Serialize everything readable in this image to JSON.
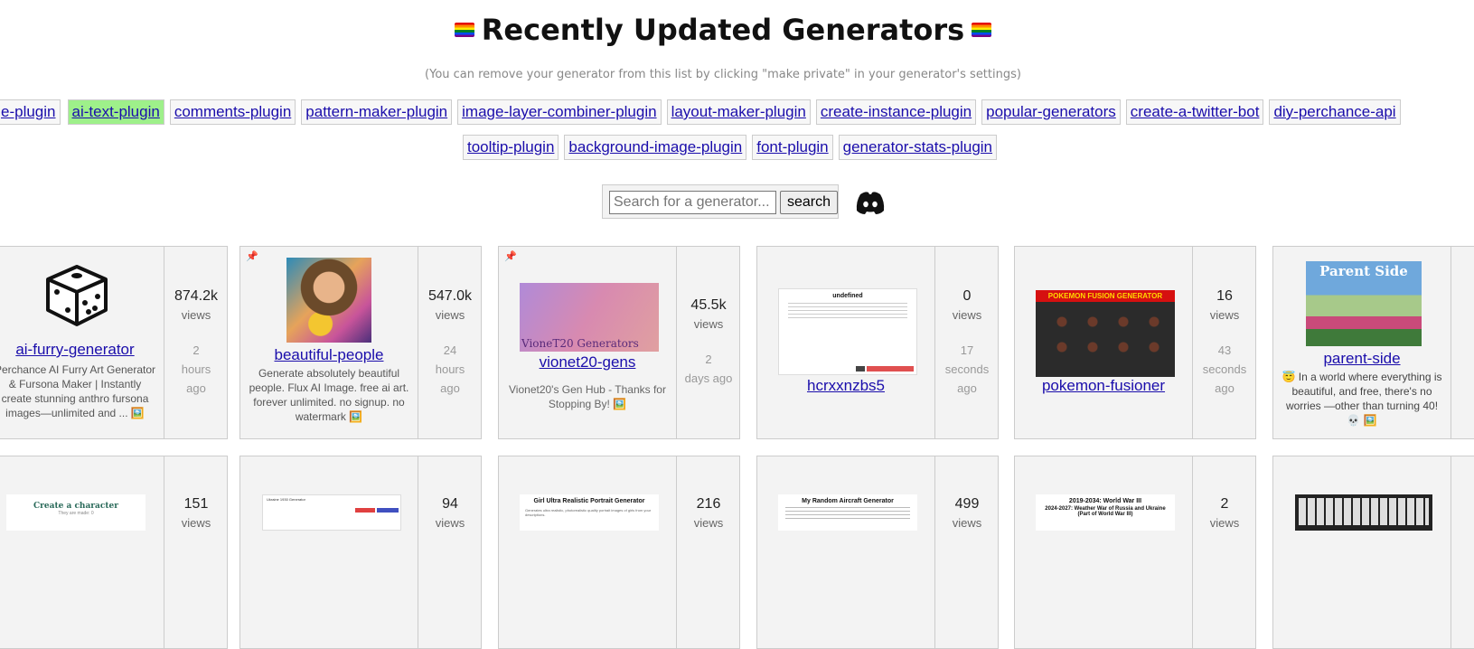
{
  "header": {
    "title": "Recently Updated Generators",
    "subtitle": "(You can remove your generator from this list by clicking \"make private\" in your generator's settings)"
  },
  "tags_row1": [
    "e-plugin",
    "ai-text-plugin",
    "comments-plugin",
    "pattern-maker-plugin",
    "image-layer-combiner-plugin",
    "layout-maker-plugin",
    "create-instance-plugin",
    "popular-generators",
    "create-a-twitter-bot",
    "diy-perchance-api"
  ],
  "tags_row2": [
    "tooltip-plugin",
    "background-image-plugin",
    "font-plugin",
    "generator-stats-plugin"
  ],
  "active_tag": "ai-text-plugin",
  "search": {
    "placeholder": "Search for a generator...",
    "button": "search"
  },
  "cards_row1": [
    {
      "name": "ai-furry-generator",
      "views": "874.2k",
      "views_label": "views",
      "ago": [
        "2",
        "hours",
        "ago"
      ],
      "desc": "Perchance AI Furry Art Generator & Fursona Maker | Instantly create stunning anthro fursona images—unlimited and ... 🖼️"
    },
    {
      "name": "beautiful-people",
      "views": "547.0k",
      "views_label": "views",
      "ago": [
        "24",
        "hours",
        "ago"
      ],
      "desc": "Generate absolutely beautiful people. Flux AI Image. free ai art. forever unlimited. no signup. no watermark 🖼️"
    },
    {
      "name": "vionet20-gens",
      "views": "45.5k",
      "views_label": "views",
      "ago": [
        "2",
        "days ago"
      ],
      "desc": "Vionet20's Gen Hub - Thanks for Stopping By! 🖼️",
      "thumb_text": "VioneT20 Generators"
    },
    {
      "name": "hcrxxnzbs5",
      "views": "0",
      "views_label": "views",
      "ago": [
        "17",
        "seconds",
        "ago"
      ],
      "desc": "",
      "thumb_text": "undefined"
    },
    {
      "name": "pokemon-fusioner",
      "views": "16",
      "views_label": "views",
      "ago": [
        "43",
        "seconds",
        "ago"
      ],
      "desc": "",
      "thumb_text": "POKEMON FUSION GENERATOR"
    },
    {
      "name": "parent-side",
      "views": "",
      "views_label": "",
      "ago": [],
      "desc": "😇 In a world where everything is beautiful, and free, there's no worries —other than turning 40! 💀 🖼️",
      "thumb_text": "Parent Side"
    }
  ],
  "cards_row2": [
    {
      "views": "151",
      "thumb_text": "Create a character",
      "thumb_sub": "They are made: 0"
    },
    {
      "views": "94",
      "thumb_text": "Ukraine 1930 Generator"
    },
    {
      "views": "216",
      "thumb_text": "Girl Ultra Realistic Portrait Generator",
      "thumb_sub": "Generates ultra realistic, photorealistic quality portrait images of girls from your descriptions."
    },
    {
      "views": "499",
      "thumb_text": "My Random Aircraft Generator"
    },
    {
      "views": "2",
      "thumb_text": "2019-2034: World War III",
      "thumb_sub": "2024-2027: Weather War of Russia and Ukraine (Part of World War III)"
    },
    {
      "views": "",
      "thumb_text": ""
    }
  ],
  "colors": {
    "link": "#1a0dab",
    "active_tag": "#9ef08a",
    "card_bg": "#f3f3f3",
    "border": "#cccccc"
  }
}
